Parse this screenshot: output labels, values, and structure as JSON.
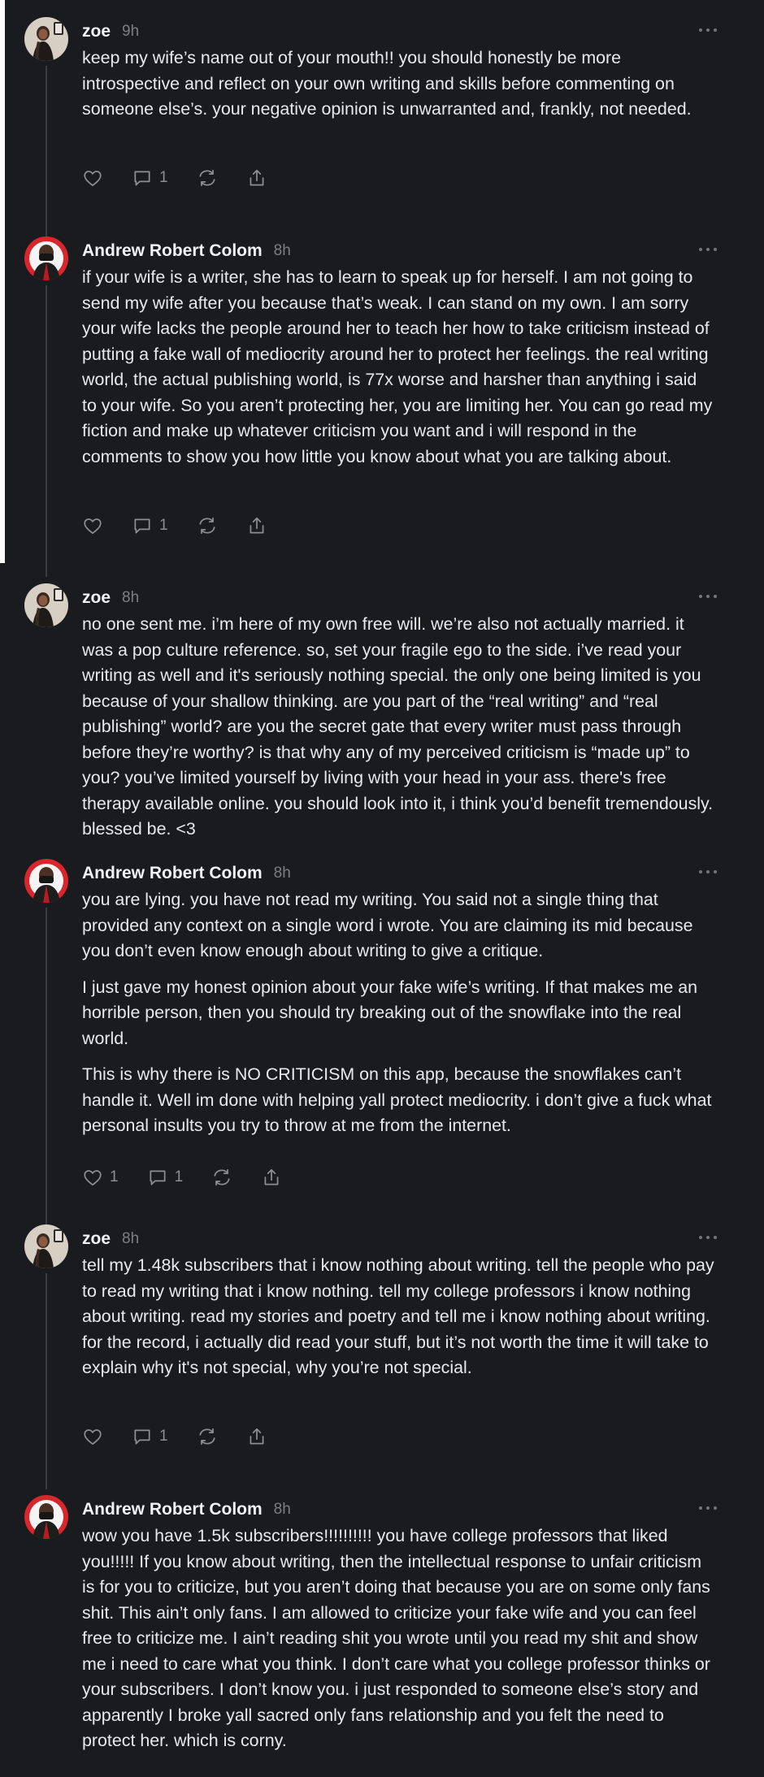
{
  "comments": [
    {
      "author": "zoe",
      "time": "9h",
      "paragraphs": [
        "keep my wife’s name out of your mouth!! you should honestly be more introspective and reflect on your own writing and skills before commenting on someone else’s. your negative opinion is unwarranted and, frankly, not needed."
      ],
      "likes": "",
      "replies": "1"
    },
    {
      "author": "Andrew Robert Colom",
      "time": "8h",
      "paragraphs": [
        "if your wife is a writer, she has to learn to speak up for herself. I am not going to send my wife after you because that’s weak. I can stand on my own. I am sorry your wife lacks the people around her to teach her how to take criticism instead of putting a fake wall of mediocrity around her to protect her feelings. the real writing world, the actual publishing world, is 77x worse and harsher than anything i said to your wife. So you aren’t protecting her, you are limiting her. You can go read my fiction and make up whatever criticism you want and i will respond in the comments to show you how little you know about what you are talking about."
      ],
      "likes": "",
      "replies": "1"
    },
    {
      "author": "zoe",
      "time": "8h",
      "paragraphs": [
        "no one sent me. i’m here of my own free will. we’re also not actually married. it was a pop culture reference. so, set your fragile ego to the side. i’ve read your writing as well and it's seriously nothing special. the only one being limited is you because of your shallow thinking. are you part of the “real writing” and “real publishing” world? are you the secret gate that every writer must pass through before they’re worthy? is that why any of my perceived criticism is “made up” to you? you’ve limited yourself by living with your head in your ass. there's free therapy available online. you should look into it, i think you’d benefit tremendously. blessed be. <3"
      ],
      "likes": "",
      "replies": ""
    },
    {
      "author": "Andrew Robert Colom",
      "time": "8h",
      "paragraphs": [
        "you are lying. you have not read my writing. You said not a single thing that provided any context on a single word i wrote. You are claiming its mid because you don’t even know enough about writing to give a critique.",
        "I just gave my honest opinion about your fake wife’s writing. If that makes me an horrible person, then you should try breaking out of the snowflake into the real world.",
        "This is why there is NO CRITICISM on this app, because the snowflakes can’t handle it. Well im done with helping yall protect mediocrity. i don’t give a fuck what personal insults you try to throw at me from the internet."
      ],
      "likes": "1",
      "replies": "1"
    },
    {
      "author": "zoe",
      "time": "8h",
      "paragraphs": [
        "tell my 1.48k subscribers that i know nothing about writing. tell the people who pay to read my writing that i know nothing. tell my college professors i know nothing about writing. read my stories and poetry and tell me i know nothing about writing. for the record, i actually did read your stuff, but it’s not worth the time it will take to explain why it's not special, why you’re not special."
      ],
      "likes": "",
      "replies": "1"
    },
    {
      "author": "Andrew Robert Colom",
      "time": "8h",
      "paragraphs": [
        "wow you have 1.5k subscribers!!!!!!!!!! you have college professors that liked you!!!!! If you know about writing, then the intellectual response to unfair criticism is for you to criticize, but you aren’t doing that because you are on some only fans shit. This ain’t only fans. I am allowed to criticize  your fake wife and you can feel free to criticize me. I ain’t reading shit you wrote until you read my shit and show me i need to care what you think. I don’t care what you college professor thinks or your subscribers. I don’t know you. i just responded to someone else’s story and apparently I broke yall sacred only fans relationship and you felt the need to protect her. which is corny."
      ],
      "likes": "",
      "replies": ""
    }
  ],
  "colors": {
    "background": "#1a1b1e",
    "text": "#e9e9eb",
    "muted": "#7d7e84",
    "connector": "#3a3b40"
  },
  "icons": [
    "heart-icon",
    "comment-icon",
    "restack-icon",
    "share-icon",
    "more-icon"
  ]
}
